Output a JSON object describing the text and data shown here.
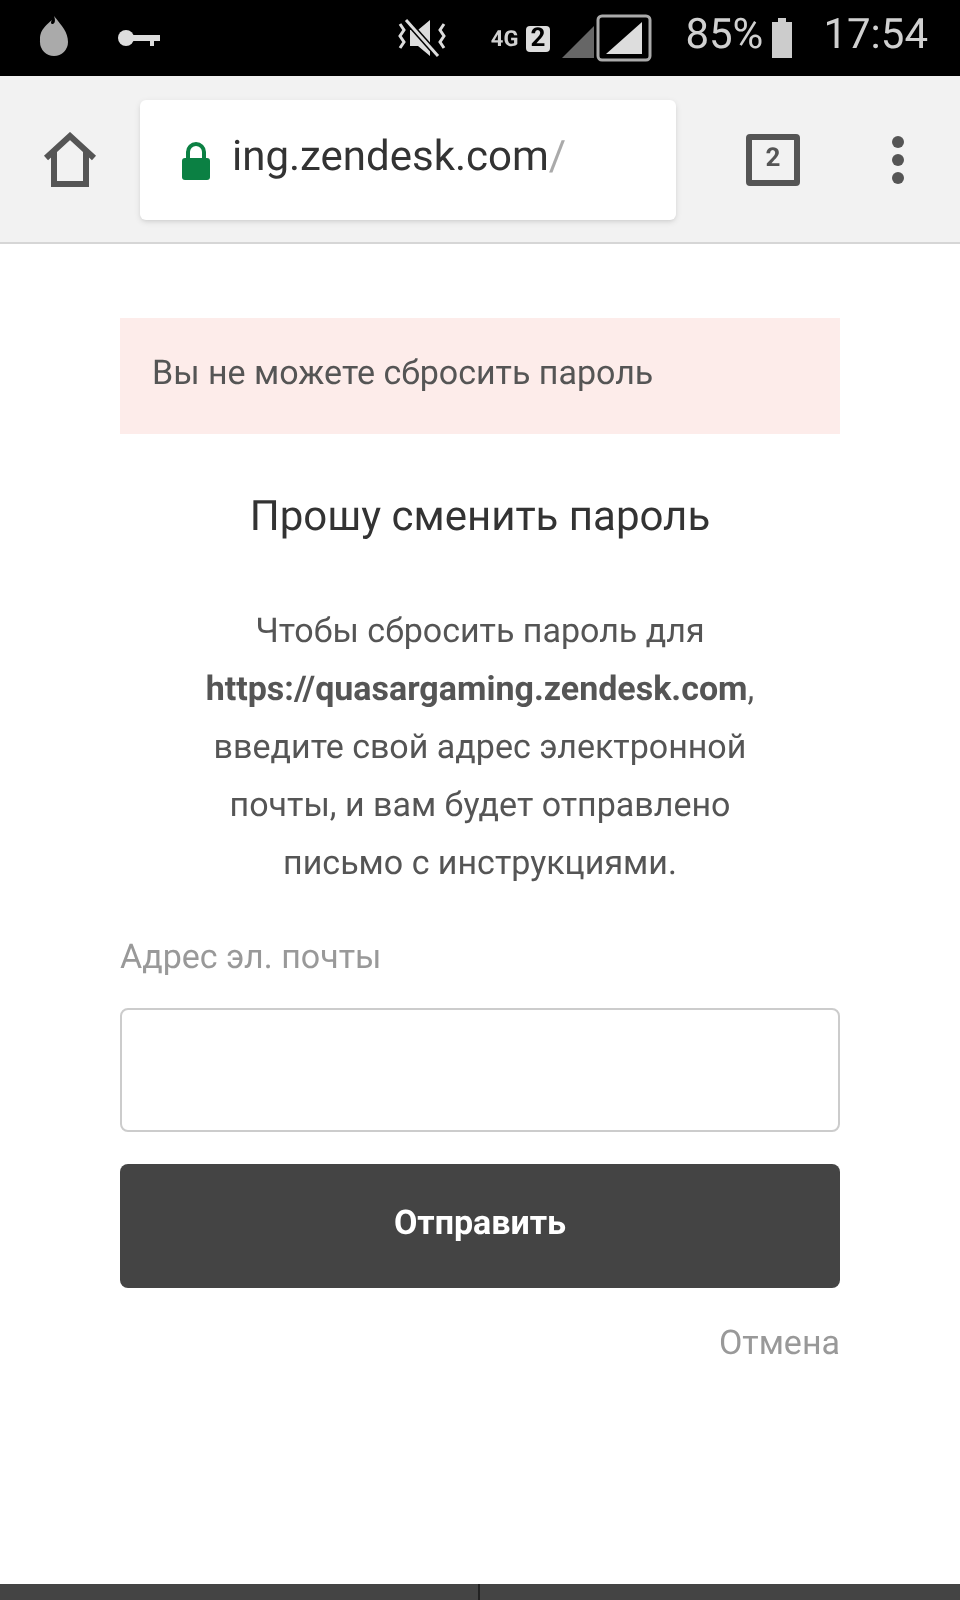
{
  "status_bar": {
    "network": "4G",
    "sim": "2",
    "battery": "85%",
    "time": "17:54"
  },
  "browser": {
    "url_host": "ing.zendesk.com",
    "url_path": "/",
    "secure": true,
    "tab_count": "2"
  },
  "alert": "Вы не можете сбросить пароль",
  "title": "Прошу сменить пароль",
  "description": "Чтобы сбросить пароль для **https://quasargaming.zendesk.com**, введите свой адрес электронной почты, и вам будет отправлено письмо с инструкциями.",
  "email": {
    "label": "Адрес эл. почты"
  },
  "submit": "Отправить",
  "cancel": "Отмена"
}
